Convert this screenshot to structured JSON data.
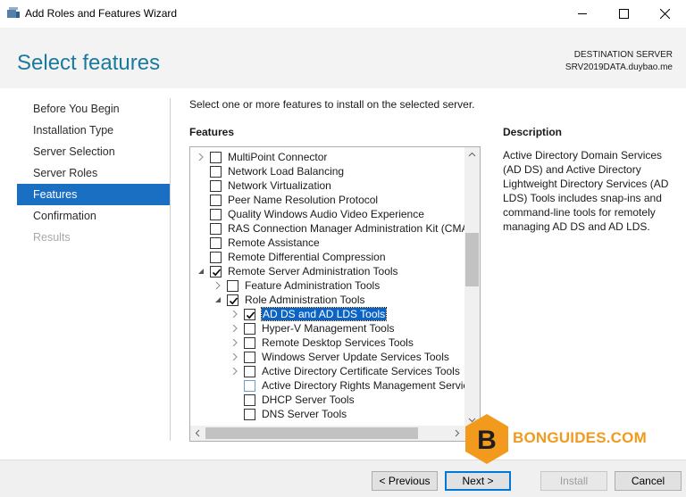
{
  "window": {
    "title": "Add Roles and Features Wizard"
  },
  "header": {
    "page_title": "Select features",
    "destination_label": "DESTINATION SERVER",
    "destination_server": "SRV2019DATA.duybao.me"
  },
  "nav": {
    "items": [
      {
        "label": "Before You Begin",
        "state": "normal"
      },
      {
        "label": "Installation Type",
        "state": "normal"
      },
      {
        "label": "Server Selection",
        "state": "normal"
      },
      {
        "label": "Server Roles",
        "state": "normal"
      },
      {
        "label": "Features",
        "state": "active"
      },
      {
        "label": "Confirmation",
        "state": "normal"
      },
      {
        "label": "Results",
        "state": "disabled"
      }
    ]
  },
  "main": {
    "instruction": "Select one or more features to install on the selected server.",
    "features_heading": "Features",
    "tree": [
      {
        "label": "MultiPoint Connector",
        "level": 0,
        "expander": "collapsed",
        "checked": false
      },
      {
        "label": "Network Load Balancing",
        "level": 0,
        "expander": "none",
        "checked": false
      },
      {
        "label": "Network Virtualization",
        "level": 0,
        "expander": "none",
        "checked": false
      },
      {
        "label": "Peer Name Resolution Protocol",
        "level": 0,
        "expander": "none",
        "checked": false
      },
      {
        "label": "Quality Windows Audio Video Experience",
        "level": 0,
        "expander": "none",
        "checked": false
      },
      {
        "label": "RAS Connection Manager Administration Kit (CMAK)",
        "level": 0,
        "expander": "none",
        "checked": false
      },
      {
        "label": "Remote Assistance",
        "level": 0,
        "expander": "none",
        "checked": false
      },
      {
        "label": "Remote Differential Compression",
        "level": 0,
        "expander": "none",
        "checked": false
      },
      {
        "label": "Remote Server Administration Tools",
        "level": 0,
        "expander": "expanded",
        "checked": true
      },
      {
        "label": "Feature Administration Tools",
        "level": 1,
        "expander": "collapsed",
        "checked": false
      },
      {
        "label": "Role Administration Tools",
        "level": 1,
        "expander": "expanded",
        "checked": true
      },
      {
        "label": "AD DS and AD LDS Tools",
        "level": 2,
        "expander": "collapsed",
        "checked": true,
        "selected": true
      },
      {
        "label": "Hyper-V Management Tools",
        "level": 2,
        "expander": "collapsed",
        "checked": false
      },
      {
        "label": "Remote Desktop Services Tools",
        "level": 2,
        "expander": "collapsed",
        "checked": false
      },
      {
        "label": "Windows Server Update Services Tools",
        "level": 2,
        "expander": "collapsed",
        "checked": false
      },
      {
        "label": "Active Directory Certificate Services Tools",
        "level": 2,
        "expander": "collapsed",
        "checked": false
      },
      {
        "label": "Active Directory Rights Management Services Tools",
        "level": 2,
        "expander": "none",
        "checked": false,
        "light": true
      },
      {
        "label": "DHCP Server Tools",
        "level": 2,
        "expander": "none",
        "checked": false
      },
      {
        "label": "DNS Server Tools",
        "level": 2,
        "expander": "none",
        "checked": false
      }
    ],
    "description_heading": "Description",
    "description_text": "Active Directory Domain Services (AD DS) and Active Directory Lightweight Directory Services (AD LDS) Tools includes snap-ins and command-line tools for remotely managing AD DS and AD LDS."
  },
  "footer": {
    "previous_label": "< Previous",
    "next_label": "Next >",
    "install_label": "Install",
    "cancel_label": "Cancel"
  },
  "watermark": {
    "text": "BONGUIDES.COM",
    "logo_letter": "B"
  },
  "colors": {
    "accent": "#1b6fc3",
    "title_blue": "#1a7a9e",
    "watermark_orange": "#f29a1e"
  }
}
